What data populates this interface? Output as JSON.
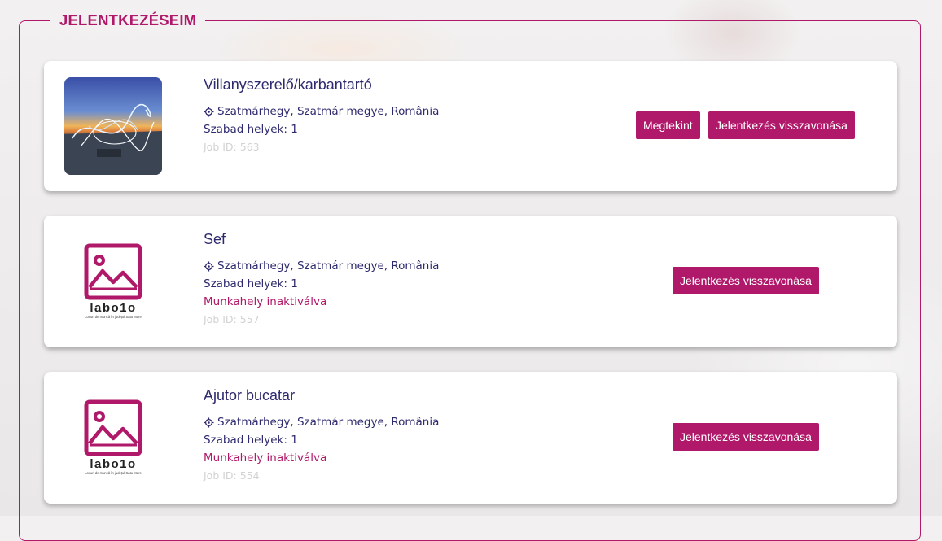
{
  "section": {
    "title": "JELENTKEZÉSEIM"
  },
  "logo": {
    "brand_text": "labo1o",
    "tagline": "Locuri de muncă în județul Satu Mare"
  },
  "applications": [
    {
      "title": "Villanyszerelő/karbantartó",
      "location": "Szatmárhegy, Szatmár megye, România",
      "free_places": "Szabad helyek: 1",
      "status": "",
      "job_id": "Job ID: 563",
      "view_label": "Megtekint",
      "withdraw_label": "Jelentkezés visszavonása"
    },
    {
      "title": "Sef",
      "location": "Szatmárhegy, Szatmár megye, România",
      "free_places": "Szabad helyek: 1",
      "status": "Munkahely inaktiválva",
      "job_id": "Job ID: 557",
      "withdraw_label": "Jelentkezés visszavonása"
    },
    {
      "title": "Ajutor bucatar",
      "location": "Szatmárhegy, Szatmár megye, România",
      "free_places": "Szabad helyek: 1",
      "status": "Munkahely inaktiválva",
      "job_id": "Job ID: 554",
      "withdraw_label": "Jelentkezés visszavonása"
    }
  ],
  "colors": {
    "accent": "#b0186a",
    "text": "#2e2a6e",
    "muted": "#d2d2d2"
  },
  "icons": {
    "location": "location-crosshair-icon",
    "placeholder": "image-placeholder-icon"
  }
}
